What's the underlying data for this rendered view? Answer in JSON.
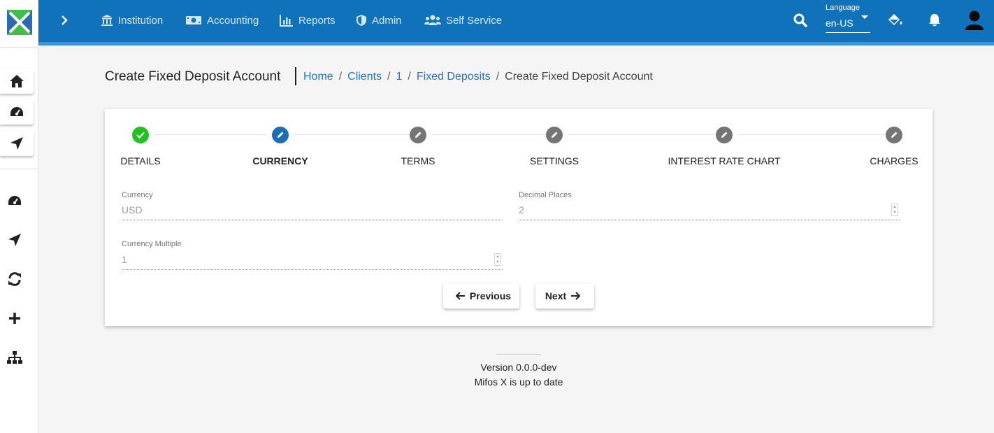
{
  "topbar": {
    "nav": [
      {
        "label": "Institution",
        "icon": "bank-icon"
      },
      {
        "label": "Accounting",
        "icon": "money-icon"
      },
      {
        "label": "Reports",
        "icon": "chart-icon"
      },
      {
        "label": "Admin",
        "icon": "shield-icon"
      },
      {
        "label": "Self Service",
        "icon": "users-icon"
      }
    ],
    "language_label": "Language",
    "language_value": "en-US"
  },
  "page": {
    "title": "Create Fixed Deposit Account",
    "breadcrumb": {
      "home": "Home",
      "clients": "Clients",
      "client_id": "1",
      "fixed_deposits": "Fixed Deposits",
      "current": "Create Fixed Deposit Account",
      "separator": "/"
    }
  },
  "stepper": {
    "steps": [
      {
        "label": "DETAILS",
        "state": "done"
      },
      {
        "label": "CURRENCY",
        "state": "active"
      },
      {
        "label": "TERMS",
        "state": "pending"
      },
      {
        "label": "SETTINGS",
        "state": "pending"
      },
      {
        "label": "INTEREST RATE CHART",
        "state": "pending"
      },
      {
        "label": "CHARGES",
        "state": "pending"
      }
    ]
  },
  "form": {
    "currency_label": "Currency",
    "currency_value": "USD",
    "decimal_label": "Decimal Places",
    "decimal_value": "2",
    "multiple_label": "Currency Multiple",
    "multiple_value": "1"
  },
  "buttons": {
    "previous": "Previous",
    "next": "Next"
  },
  "footer": {
    "version": "Version 0.0.0-dev",
    "status": "Mifos X is up to date"
  },
  "colors": {
    "topbar": "#0f72bb",
    "link": "#1a76c8",
    "step_done": "#1fc31f",
    "step_active": "#1a6fb5",
    "step_pending": "#757575"
  }
}
